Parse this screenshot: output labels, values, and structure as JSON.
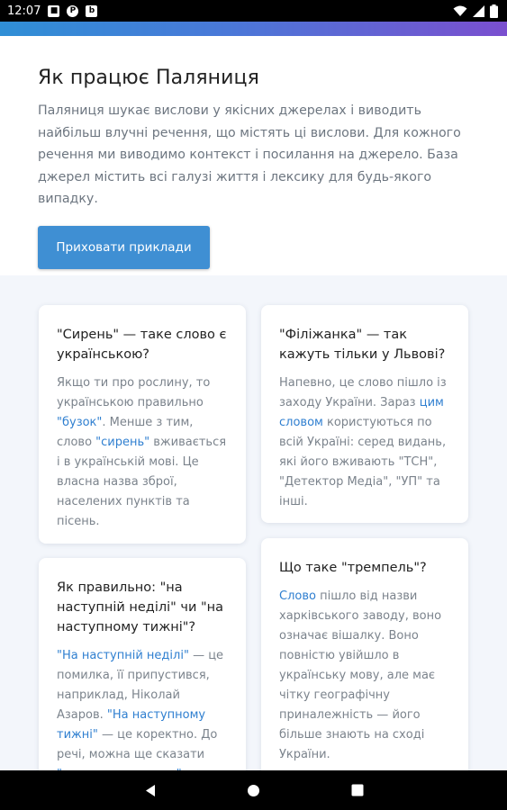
{
  "status_bar": {
    "time": "12:07"
  },
  "hero": {
    "title": "Як працює Паляниця",
    "description": "Паляниця шукає вислови у якісних джерелах і виводить найбільш влучні речення, що містять ці вислови. Для кожного речення ми виводимо контекст і посилання на джерело. База джерел містить всі галузі життя і лексику для будь-якого випадку.",
    "button_label": "Приховати приклади"
  },
  "cards": [
    {
      "title": "\"Сирень\" — таке слово є українською?",
      "segments": [
        {
          "text": "Якщо ти про рослину, то українською правильно "
        },
        {
          "text": "\"бузок\"",
          "link": true
        },
        {
          "text": ". Менше з тим, слово "
        },
        {
          "text": "\"сирень\"",
          "link": true
        },
        {
          "text": " вживається і в українській мові. Це власна назва зброї, населених пунктів та пісень."
        }
      ]
    },
    {
      "title": "\"Філіжанка\" — так кажуть тільки у Львові?",
      "segments": [
        {
          "text": "Напевно, це слово пішло із заходу України. Зараз "
        },
        {
          "text": "цим словом",
          "link": true
        },
        {
          "text": " користуються по всій Україні: серед видань, які його вживають \"ТСН\", \"Детектор Медіа\", \"УП\" та інші."
        }
      ]
    },
    {
      "title": "Як правильно: \"на наступній неділі\" чи \"на наступному тижні\"?",
      "segments": [
        {
          "text": "\"На наступній неділі\"",
          "link": true
        },
        {
          "text": " — це помилка, її припустився, наприклад, Ніколай Азаров. "
        },
        {
          "text": "\"На наступному тижні\"",
          "link": true
        },
        {
          "text": " — це коректно. До речі, можна ще сказати "
        },
        {
          "text": "\"наступного тижня\"",
          "link": true
        },
        {
          "text": "."
        }
      ]
    },
    {
      "title": "Що таке \"тремпель\"?",
      "segments": [
        {
          "text": "Слово",
          "link": true
        },
        {
          "text": " пішло від назви харківського заводу, воно означає вішалку. Воно повністю увійшло в українську мову, але має чітку географічну приналежність — його більше знають на сході України."
        }
      ]
    }
  ]
}
